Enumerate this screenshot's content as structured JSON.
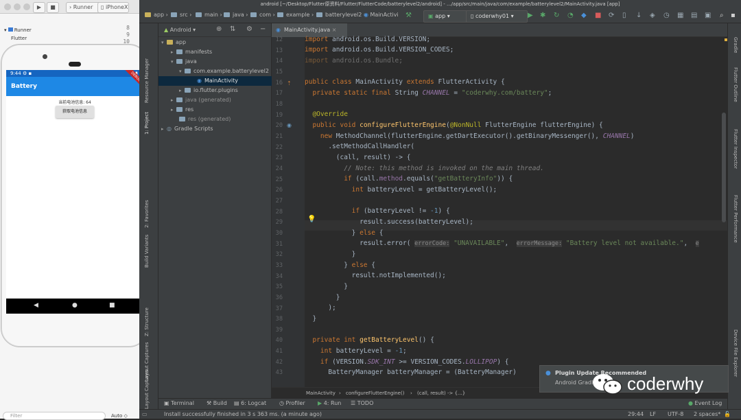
{
  "xcode": {
    "scheme": "Runner",
    "device": "iPhoneX",
    "nav_root": "Runner",
    "nav_child": "Flutter",
    "line_numbers": [
      "8",
      "9",
      "10"
    ],
    "filter_placeholder": "Filter",
    "auto_label": "Auto"
  },
  "simulator": {
    "time": "9:44",
    "app_title": "Battery",
    "debug_label": "DEBUG",
    "battery_text": "当前电池信息: 64",
    "button_label": "获取电池信息"
  },
  "studio": {
    "window_title": "android [~/Desktop/Flutter原资料/Flutter/FlutterCode/batterylevel2/android] - .../app/src/main/java/com/example/batterylevel2/MainActivity.java [app]",
    "breadcrumbs": [
      "app",
      "src",
      "main",
      "java",
      "com",
      "example",
      "batterylevel2",
      "MainActivi"
    ],
    "run_config": "app",
    "device": "coderwhy01",
    "project_view": "Android",
    "tree": [
      {
        "label": "app",
        "depth": 0
      },
      {
        "label": "manifests",
        "depth": 1
      },
      {
        "label": "java",
        "depth": 1
      },
      {
        "label": "com.example.batterylevel2",
        "depth": 2
      },
      {
        "label": "MainActivity",
        "depth": 3
      },
      {
        "label": "io.flutter.plugins",
        "depth": 2
      },
      {
        "label": "java (generated)",
        "depth": 1
      },
      {
        "label": "res",
        "depth": 1
      },
      {
        "label": "res (generated)",
        "depth": 1
      },
      {
        "label": "Gradle Scripts",
        "depth": 0
      }
    ],
    "editor_tab": "MainActivity.java",
    "left_tools": [
      "Resource Manager",
      "1: Project",
      "2: Favorites",
      "Build Variants",
      "Z: Structure",
      "Layout Captures",
      "Layout Captures"
    ],
    "right_tools": [
      "Gradle",
      "Flutter Outline",
      "Flutter Inspector",
      "Flutter Performance",
      "Device File Explorer"
    ],
    "code_breadcrumb": [
      "MainActivity",
      "configureFlutterEngine()",
      "(call, result) -> {...}"
    ],
    "bottom_tools": [
      "Terminal",
      "Build",
      "6: Logcat",
      "Profiler",
      "4: Run",
      "TODO",
      "Event Log"
    ],
    "status_message": "Install successfully finished in 3 s 363 ms. (a minute ago)",
    "status_position": "29:44",
    "status_lf": "LF",
    "status_encoding": "UTF-8",
    "status_indent": "2 spaces*",
    "notification_title": "Plugin Update Recommended",
    "notification_body": "Android Gradle",
    "watermark": "coderwhy"
  },
  "code": {
    "line_numbers": [
      "12",
      "13",
      "14",
      "15",
      "16",
      "17",
      "18",
      "19",
      "20",
      "21",
      "22",
      "23",
      "24",
      "25",
      "26",
      "27",
      "28",
      "29",
      "30",
      "31",
      "32",
      "33",
      "34",
      "35",
      "36",
      "37",
      "38",
      "39",
      "40",
      "41",
      "42",
      "43"
    ],
    "hint_error_code": "errorCode:",
    "hint_error_message": "errorMessage:",
    "str_channel": "\"coderwhy.com/battery\"",
    "str_method": "\"getBatteryInfo\"",
    "str_unavailable": "\"UNAVAILABLE\"",
    "str_not_available": "\"Battery level not available.\""
  }
}
